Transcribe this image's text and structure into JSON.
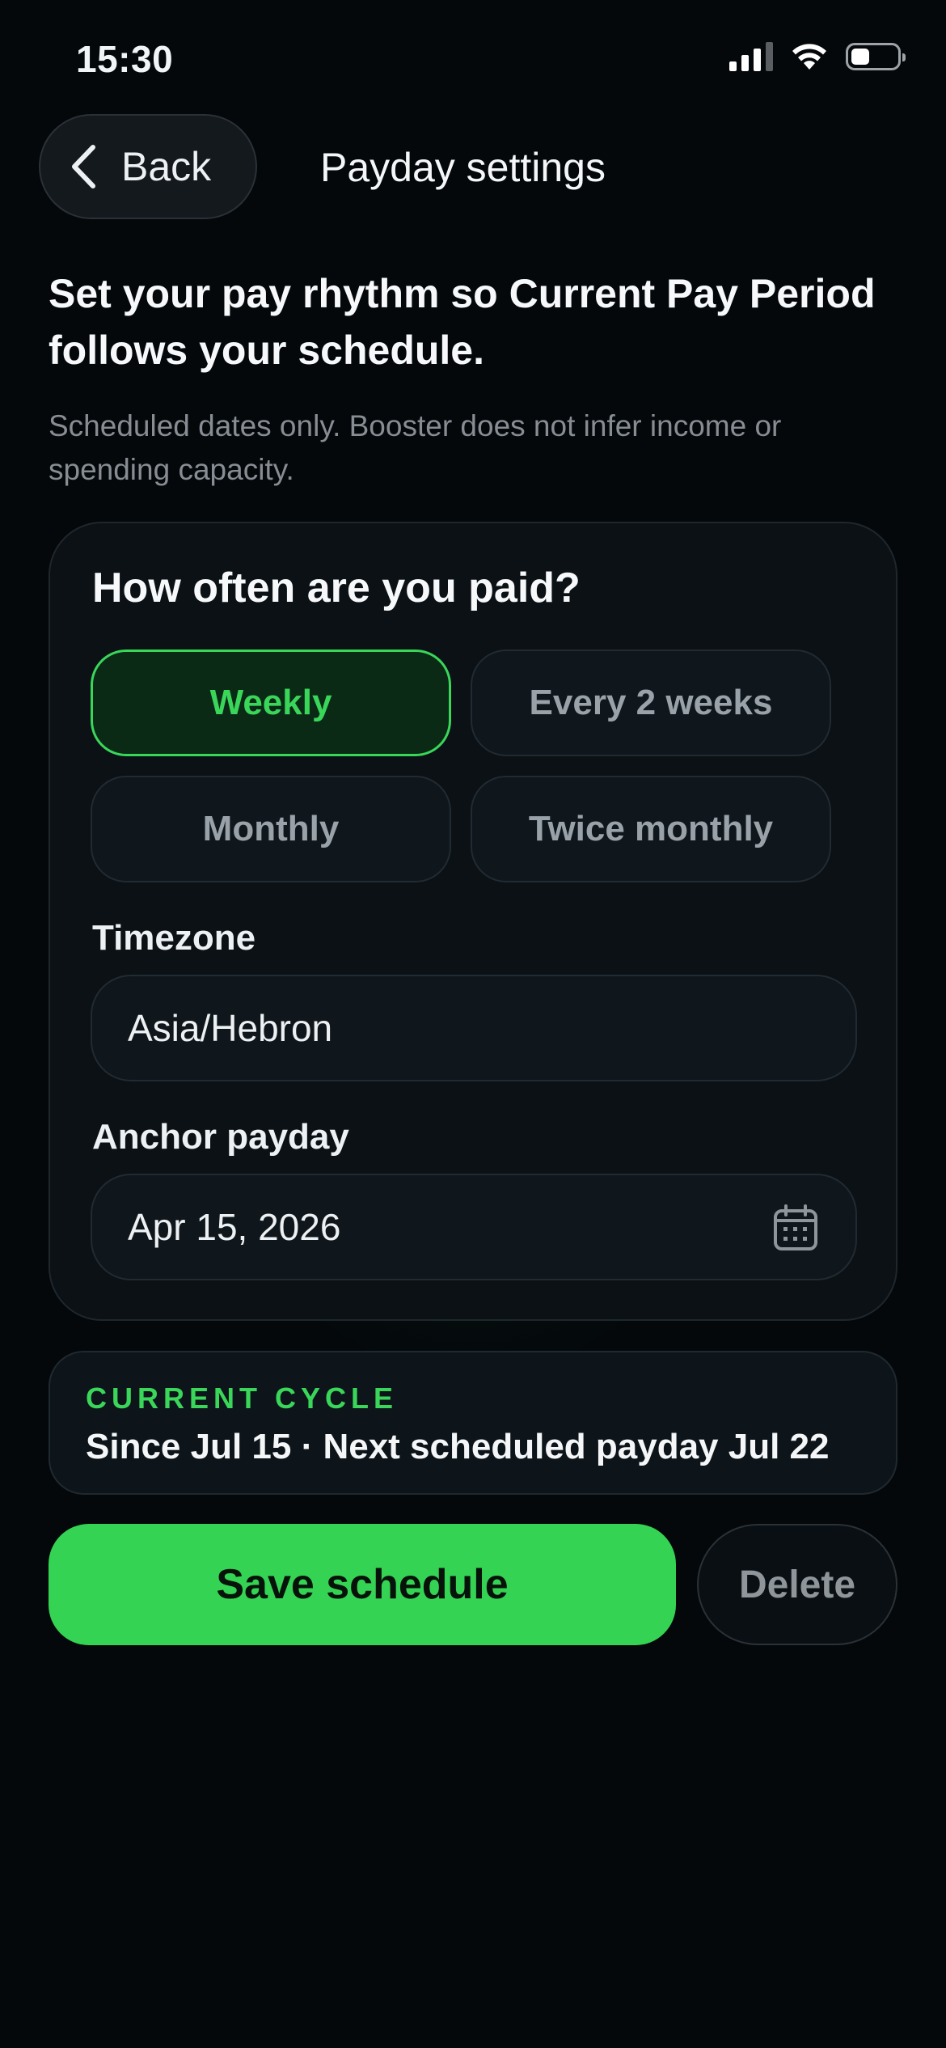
{
  "status_bar": {
    "time": "15:30",
    "icons": [
      "cellular-signal-icon",
      "wifi-icon",
      "battery-icon"
    ]
  },
  "header": {
    "back_label": "Back",
    "title": "Payday settings"
  },
  "intro": {
    "headline": "Set your pay rhythm so Current Pay Period follows your schedule.",
    "disclaimer": "Scheduled dates only. Booster does not infer income or spending capacity."
  },
  "frequency": {
    "question": "How often are you paid?",
    "options": [
      {
        "label": "Weekly",
        "selected": true
      },
      {
        "label": "Every 2 weeks",
        "selected": false
      },
      {
        "label": "Monthly",
        "selected": false
      },
      {
        "label": "Twice monthly",
        "selected": false
      }
    ]
  },
  "timezone": {
    "label": "Timezone",
    "value": "Asia/Hebron"
  },
  "anchor_payday": {
    "label": "Anchor payday",
    "value": "Apr 15, 2026",
    "icon": "calendar-icon"
  },
  "current_cycle": {
    "kicker": "CURRENT CYCLE",
    "summary": "Since Jul 15 · Next scheduled payday Jul 22"
  },
  "actions": {
    "save_label": "Save schedule",
    "delete_label": "Delete"
  },
  "colors": {
    "accent": "#35d353",
    "background": "#04080b",
    "card": "#0b1115",
    "muted": "#878d93"
  }
}
